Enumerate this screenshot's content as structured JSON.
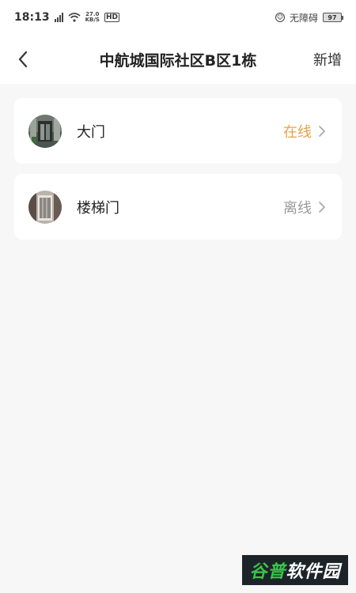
{
  "status_bar": {
    "time": "18:13",
    "network_speed_value": "27.0",
    "network_speed_unit": "KB/S",
    "hd_label": "HD",
    "accessibility_label": "无障碍",
    "battery_level": "97"
  },
  "header": {
    "title": "中航城国际社区B区1栋",
    "add_label": "新增"
  },
  "doors": [
    {
      "name": "大门",
      "status": "在线",
      "status_color": "#e8a04a"
    },
    {
      "name": "楼梯门",
      "status": "离线",
      "status_color": "#9a9a9a"
    }
  ],
  "watermark": {
    "part1": "谷普",
    "part2": "软件园"
  }
}
